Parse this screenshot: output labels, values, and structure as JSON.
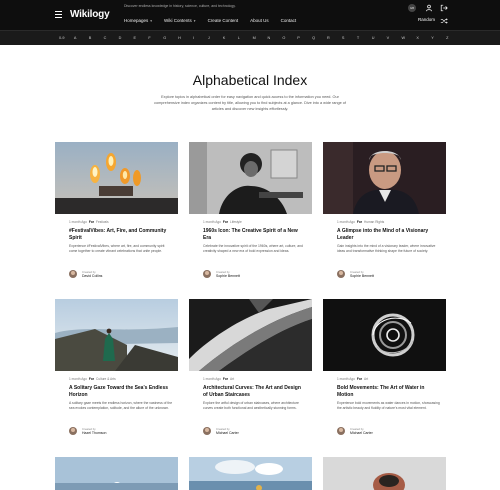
{
  "header": {
    "logo": "Wikilogy",
    "tagline": "Discover endless knowledge in history, science, culture, and technology.",
    "nav": [
      {
        "label": "Homepages",
        "has_dropdown": true
      },
      {
        "label": "Wiki Contents",
        "has_dropdown": true
      },
      {
        "label": "Create Content",
        "has_dropdown": false
      },
      {
        "label": "About Us",
        "has_dropdown": false
      },
      {
        "label": "Contact",
        "has_dropdown": false
      }
    ],
    "user_initials": "GB",
    "review_label": "Random",
    "icons": [
      "menu-icon",
      "user-icon",
      "logout-icon",
      "shuffle-icon"
    ]
  },
  "alphabet": [
    "0-9",
    "A",
    "B",
    "C",
    "D",
    "E",
    "F",
    "G",
    "H",
    "I",
    "J",
    "K",
    "L",
    "M",
    "N",
    "O",
    "P",
    "Q",
    "R",
    "S",
    "T",
    "U",
    "V",
    "W",
    "X",
    "Y",
    "Z"
  ],
  "page": {
    "title": "Alphabetical Index",
    "intro": "Explore topics in alphabetical order for easy navigation and quick access to the information you need. Our comprehensive index organizes content by title, allowing you to find subjects at a glance. Dive into a wide range of articles and discover new insights effortlessly."
  },
  "cards": [
    {
      "time": "1 month Ago",
      "for_label": "For",
      "category": "Festivals",
      "title": "#FestivalVibes: Art, Fire, and Community Spirit",
      "desc": "Experience #FestivalVibes, where art, fire, and community spirit come together to create vibrant celebrations that unite people.",
      "created_by": "Created by",
      "author": "David Collins",
      "image": "fire"
    },
    {
      "time": "1 month Ago",
      "for_label": "For",
      "category": "Lifestyle",
      "title": "1960s Icon: The Creative Spirit of a New Era",
      "desc": "Celebrate the innovative spirit of the 1960s, where art, culture, and creativity shaped a new era of bold expression and ideas.",
      "created_by": "Created by",
      "author": "Sophie Bennett",
      "image": "portrait-bw"
    },
    {
      "time": "1 month Ago",
      "for_label": "For",
      "category": "Human Rights",
      "title": "A Glimpse into the Mind of a Visionary Leader",
      "desc": "Gain insights into the mind of a visionary leader, where innovative ideas and transformative thinking shape the future of society.",
      "created_by": "Created by",
      "author": "Sophie Bennett",
      "image": "leader"
    },
    {
      "time": "1 month Ago",
      "for_label": "For",
      "category": "Culture & Arts",
      "title": "A Solitary Gaze Toward the Sea's Endless Horizon",
      "desc": "A solitary gaze meets the endless horizon, where the vastness of the sea evokes contemplation, solitude, and the allure of the unknown.",
      "created_by": "Created by",
      "author": "Hazel Thomson",
      "image": "sea"
    },
    {
      "time": "1 month Ago",
      "for_label": "For",
      "category": "Art",
      "title": "Architectural Curves: The Art and Design of Urban Staircases",
      "desc": "Explore the artful design of urban staircases, where architecture curves create both functional and aesthetically stunning forms.",
      "created_by": "Created by",
      "author": "Michael Carter",
      "image": "stairs"
    },
    {
      "time": "1 month Ago",
      "for_label": "For",
      "category": "Art",
      "title": "Bold Movements: The Art of Water in Motion",
      "desc": "Experience bold movements as water dances in motion, showcasing the artistic beauty and fluidity of nature's most vital element.",
      "created_by": "Created by",
      "author": "Michael Carter",
      "image": "water"
    }
  ]
}
